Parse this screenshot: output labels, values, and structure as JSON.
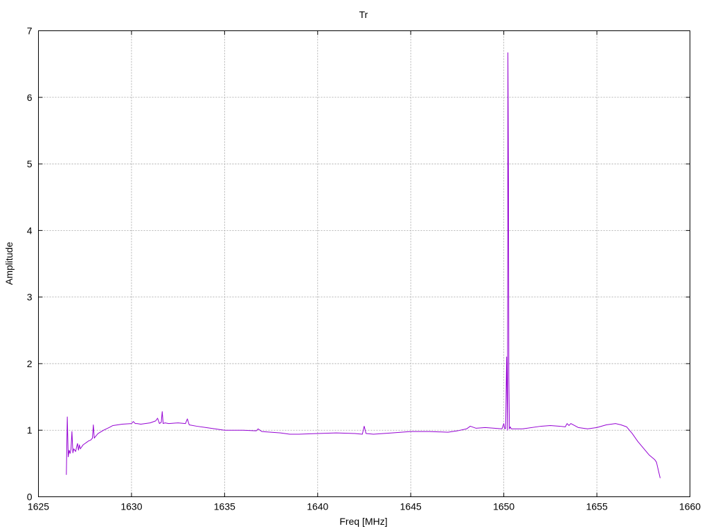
{
  "chart_data": {
    "type": "line",
    "title": "Tr",
    "xlabel": "Freq [MHz]",
    "ylabel": "Amplitude",
    "xlim": [
      1625,
      1660
    ],
    "ylim": [
      0,
      7
    ],
    "x_ticks": [
      1625,
      1630,
      1635,
      1640,
      1645,
      1650,
      1655,
      1660
    ],
    "y_ticks": [
      0,
      1,
      2,
      3,
      4,
      5,
      6,
      7
    ],
    "grid": true,
    "series_color": "#9400d3",
    "series": [
      {
        "x": [
          1626.5,
          1626.55,
          1626.6,
          1626.65,
          1626.7,
          1626.75,
          1626.8,
          1626.85,
          1626.9,
          1626.95,
          1627.0,
          1627.05,
          1627.1,
          1627.15,
          1627.2,
          1627.25,
          1627.3,
          1627.35,
          1627.4,
          1627.5,
          1627.6,
          1627.7,
          1627.8,
          1627.9,
          1627.95,
          1628.0,
          1628.05,
          1628.2,
          1628.5,
          1628.8,
          1629.0,
          1629.5,
          1630.0,
          1630.1,
          1630.2,
          1630.3,
          1630.5,
          1631.0,
          1631.3,
          1631.4,
          1631.5,
          1631.6,
          1631.65,
          1631.7,
          1631.8,
          1632.0,
          1632.5,
          1632.9,
          1633.0,
          1633.1,
          1633.5,
          1634.0,
          1635.0,
          1636.0,
          1636.7,
          1636.8,
          1637.0,
          1638.0,
          1638.5,
          1639.0,
          1640.0,
          1641.0,
          1642.0,
          1642.4,
          1642.5,
          1642.6,
          1643.0,
          1644.0,
          1645.0,
          1646.0,
          1647.0,
          1647.5,
          1648.0,
          1648.2,
          1648.5,
          1649.0,
          1649.5,
          1649.9,
          1650.0,
          1650.05,
          1650.1,
          1650.15,
          1650.2,
          1650.22,
          1650.25,
          1650.27,
          1650.3,
          1650.35,
          1650.4,
          1650.5,
          1651.0,
          1652.0,
          1652.5,
          1653.0,
          1653.3,
          1653.4,
          1653.5,
          1653.6,
          1654.0,
          1654.5,
          1655.0,
          1655.5,
          1656.0,
          1656.3,
          1656.6,
          1656.9,
          1657.2,
          1657.5,
          1657.8,
          1658.1,
          1658.2,
          1658.3,
          1658.4
        ],
        "y": [
          0.33,
          1.2,
          0.6,
          0.7,
          0.65,
          0.72,
          0.98,
          0.66,
          0.72,
          0.7,
          0.68,
          0.75,
          0.8,
          0.7,
          0.78,
          0.72,
          0.74,
          0.76,
          0.78,
          0.8,
          0.82,
          0.84,
          0.85,
          0.88,
          1.08,
          0.88,
          0.9,
          0.95,
          1.0,
          1.04,
          1.07,
          1.09,
          1.1,
          1.13,
          1.1,
          1.1,
          1.09,
          1.11,
          1.14,
          1.18,
          1.1,
          1.12,
          1.28,
          1.1,
          1.11,
          1.1,
          1.11,
          1.1,
          1.17,
          1.08,
          1.06,
          1.04,
          1.0,
          1.0,
          0.99,
          1.02,
          0.98,
          0.96,
          0.94,
          0.94,
          0.95,
          0.96,
          0.95,
          0.94,
          1.06,
          0.95,
          0.94,
          0.96,
          0.98,
          0.98,
          0.97,
          0.99,
          1.02,
          1.06,
          1.03,
          1.04,
          1.03,
          1.02,
          1.1,
          1.02,
          1.03,
          2.1,
          1.0,
          6.67,
          4.75,
          1.8,
          1.02,
          1.05,
          1.02,
          1.02,
          1.02,
          1.06,
          1.07,
          1.06,
          1.05,
          1.1,
          1.07,
          1.1,
          1.04,
          1.02,
          1.04,
          1.08,
          1.1,
          1.08,
          1.05,
          0.95,
          0.83,
          0.73,
          0.63,
          0.56,
          0.52,
          0.4,
          0.28
        ]
      }
    ]
  }
}
